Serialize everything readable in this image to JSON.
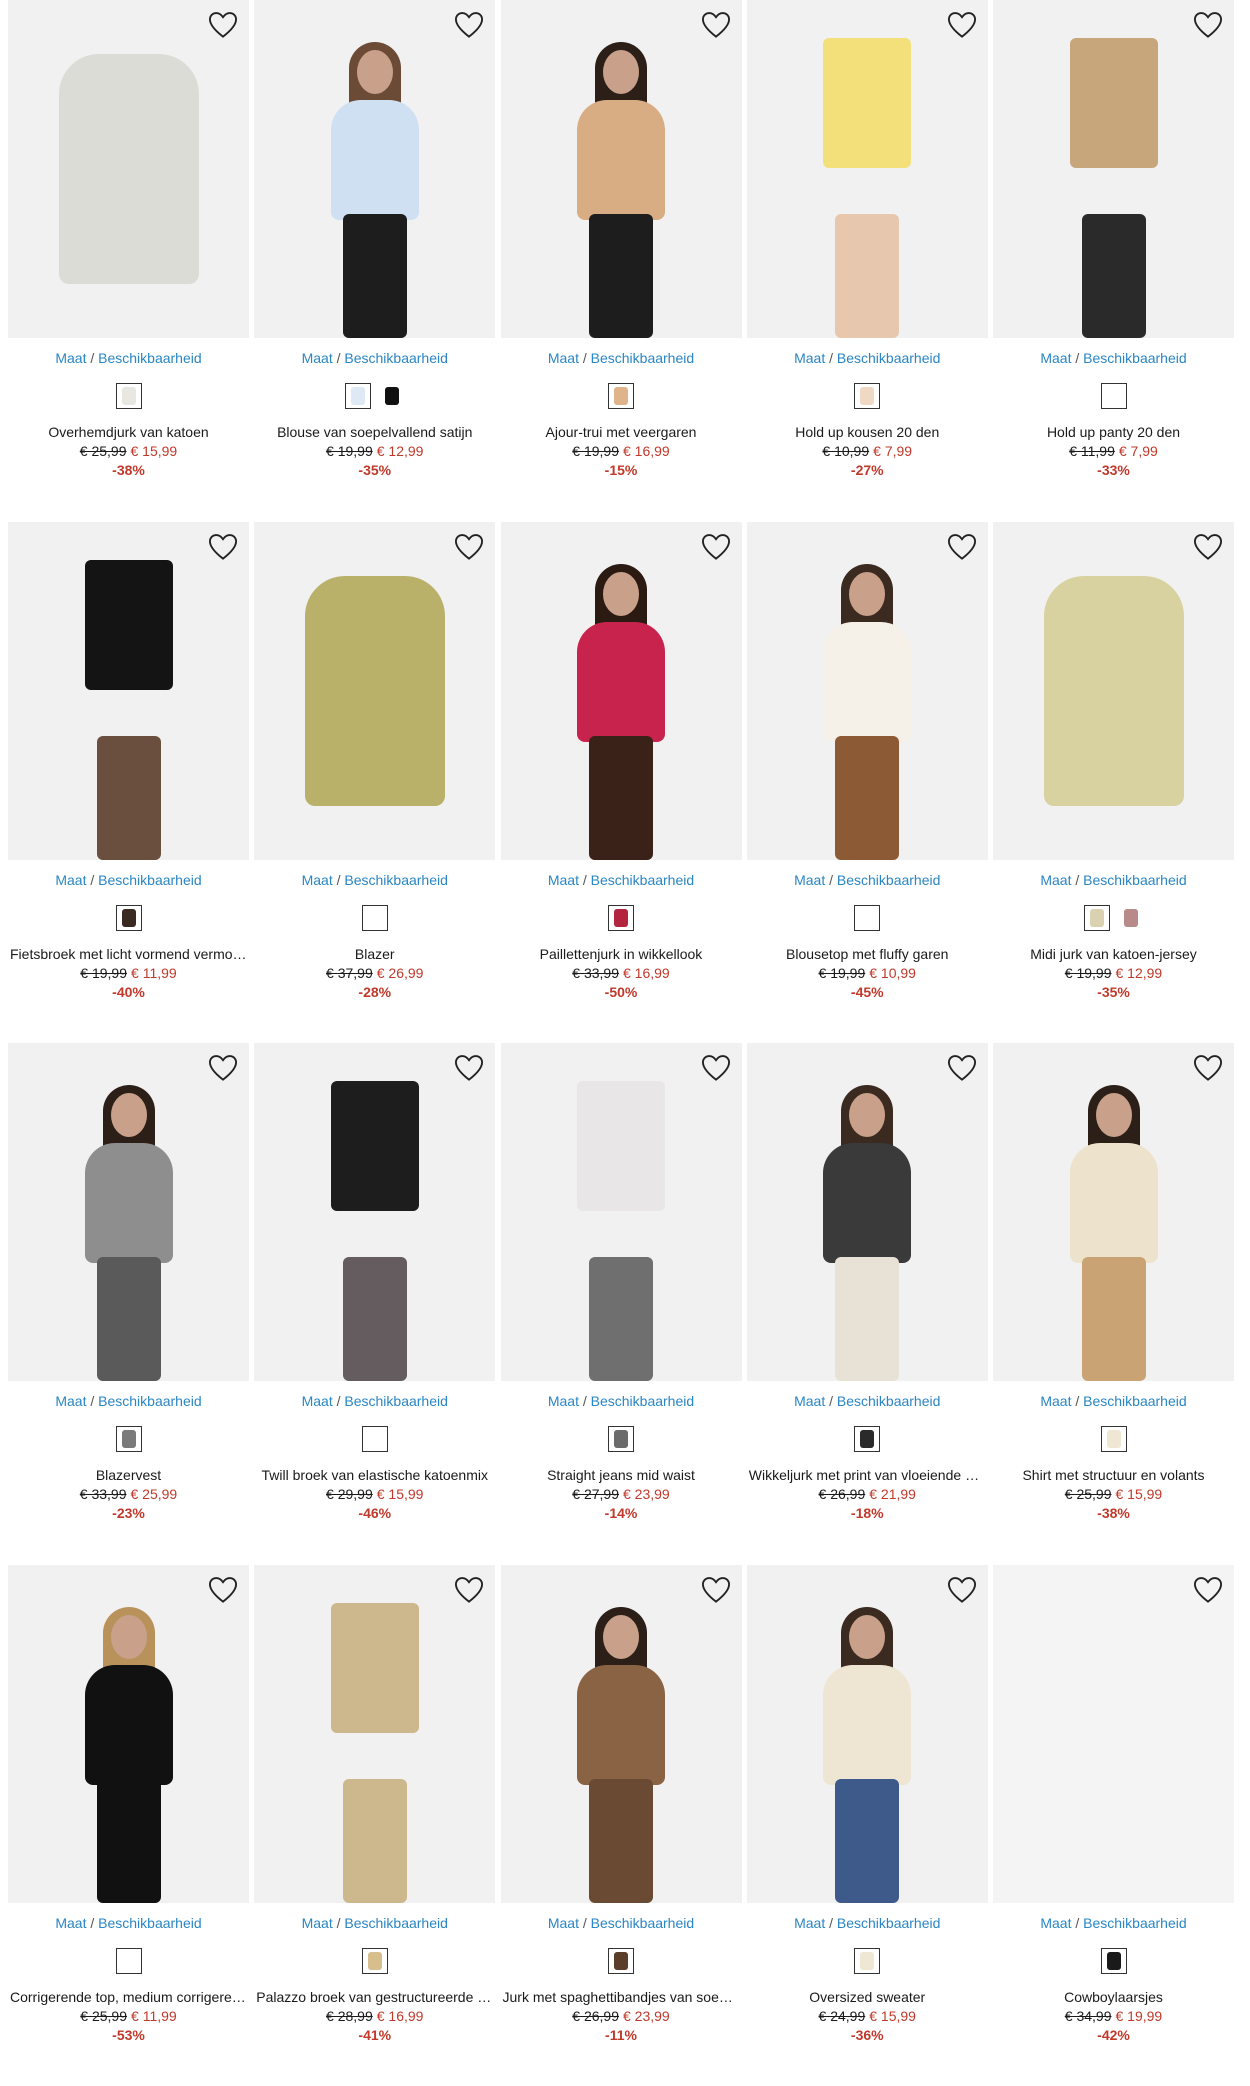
{
  "size_link": {
    "maat": "Maat",
    "sep": " / ",
    "beschikbaarheid": "Beschikbaarheid"
  },
  "colors": {
    "link": "#2a86c4",
    "sale": "#c0392b",
    "text": "#1a1a1a"
  },
  "products": [
    {
      "title": "Overhemdjurk van katoen",
      "old_price": "€ 25,99",
      "new_price": "€ 15,99",
      "discount": "-38%",
      "swatches": [
        "#e9e7e2"
      ],
      "image": {
        "kind": "flat",
        "color": "#dcdcd6"
      }
    },
    {
      "title": "Blouse van soepelvallend satijn",
      "old_price": "€ 19,99",
      "new_price": "€ 12,99",
      "discount": "-35%",
      "swatches": [
        "#dfe9f5",
        "#111111"
      ],
      "image": {
        "kind": "model",
        "top": "#cfe0f2",
        "bottom": "#1d1d1d",
        "hair": "#6b4b36"
      }
    },
    {
      "title": "Ajour-trui met veergaren",
      "old_price": "€ 19,99",
      "new_price": "€ 16,99",
      "discount": "-15%",
      "swatches": [
        "#e0b48a"
      ],
      "image": {
        "kind": "model",
        "top": "#d9ad83",
        "bottom": "#1d1d1d",
        "hair": "#2b1f18"
      }
    },
    {
      "title": "Hold up kousen 20 den",
      "old_price": "€ 10,99",
      "new_price": "€ 7,99",
      "discount": "-27%",
      "swatches": [
        "#efd8c4"
      ],
      "image": {
        "kind": "legs",
        "top": "#f3e07a",
        "bottom": "#e7c7ae",
        "hair": "#e7c7ae"
      }
    },
    {
      "title": "Hold up panty 20 den",
      "old_price": "€ 11,99",
      "new_price": "€ 7,99",
      "discount": "-33%",
      "swatches": [],
      "image": {
        "kind": "legs",
        "top": "#c8a67c",
        "bottom": "#2a2a2a",
        "hair": "#1d1d1d"
      }
    },
    {
      "title": "Fietsbroek met licht vormend vermogen",
      "old_price": "€ 19,99",
      "new_price": "€ 11,99",
      "discount": "-40%",
      "swatches": [
        "#3a2a22"
      ],
      "image": {
        "kind": "legs",
        "top": "#141414",
        "bottom": "#6b4f3e",
        "hair": "#c48e6c"
      }
    },
    {
      "title": "Blazer",
      "old_price": "€ 37,99",
      "new_price": "€ 26,99",
      "discount": "-28%",
      "swatches": [],
      "image": {
        "kind": "flat",
        "color": "#b9b169"
      }
    },
    {
      "title": "Paillettenjurk in wikkellook",
      "old_price": "€ 33,99",
      "new_price": "€ 16,99",
      "discount": "-50%",
      "swatches": [
        "#b3243f"
      ],
      "image": {
        "kind": "model",
        "top": "#c8234c",
        "bottom": "#3a2218",
        "hair": "#2a1a12"
      }
    },
    {
      "title": "Blousetop met fluffy garen",
      "old_price": "€ 19,99",
      "new_price": "€ 10,99",
      "discount": "-45%",
      "swatches": [],
      "image": {
        "kind": "model",
        "top": "#f5f1e8",
        "bottom": "#8c5a34",
        "hair": "#3b2a20"
      }
    },
    {
      "title": "Midi jurk van katoen-jersey",
      "old_price": "€ 19,99",
      "new_price": "€ 12,99",
      "discount": "-35%",
      "swatches": [
        "#d9d1b0",
        "#b88a8a"
      ],
      "image": {
        "kind": "flat",
        "color": "#d8d2a0"
      }
    },
    {
      "title": "Blazervest",
      "old_price": "€ 33,99",
      "new_price": "€ 25,99",
      "discount": "-23%",
      "swatches": [
        "#7a7a7a"
      ],
      "image": {
        "kind": "model",
        "top": "#8e8e8e",
        "bottom": "#5a5a5a",
        "hair": "#2b1f18"
      }
    },
    {
      "title": "Twill broek van elastische katoenmix",
      "old_price": "€ 29,99",
      "new_price": "€ 15,99",
      "discount": "-46%",
      "swatches": [],
      "image": {
        "kind": "legs",
        "top": "#1d1d1d",
        "bottom": "#645c5e",
        "hair": "#1d1d1d"
      }
    },
    {
      "title": "Straight jeans mid waist",
      "old_price": "€ 27,99",
      "new_price": "€ 23,99",
      "discount": "-14%",
      "swatches": [
        "#6b6b6b"
      ],
      "image": {
        "kind": "legs",
        "top": "#e8e6e6",
        "bottom": "#6f6f6f",
        "hair": "#e8e6e6"
      }
    },
    {
      "title": "Wikkeljurk met print van vloeiende viscose",
      "old_price": "€ 26,99",
      "new_price": "€ 21,99",
      "discount": "-18%",
      "swatches": [
        "#2a2a2a"
      ],
      "image": {
        "kind": "model",
        "top": "#3a3a3a",
        "bottom": "#e8e2d6",
        "hair": "#3b2a20"
      }
    },
    {
      "title": "Shirt met structuur en volants",
      "old_price": "€ 25,99",
      "new_price": "€ 15,99",
      "discount": "-38%",
      "swatches": [
        "#efe6d3"
      ],
      "image": {
        "kind": "model",
        "top": "#ede3cc",
        "bottom": "#c9a374",
        "hair": "#2b1f18"
      }
    },
    {
      "title": "Corrigerende top, medium corrigerend",
      "old_price": "€ 25,99",
      "new_price": "€ 11,99",
      "discount": "-53%",
      "swatches": [],
      "image": {
        "kind": "model",
        "top": "#111111",
        "bottom": "#111111",
        "hair": "#b8925a"
      }
    },
    {
      "title": "Palazzo broek van gestructureerde stof",
      "old_price": "€ 28,99",
      "new_price": "€ 16,99",
      "discount": "-41%",
      "swatches": [
        "#d6bf8c"
      ],
      "image": {
        "kind": "legs",
        "top": "#cdb88e",
        "bottom": "#cdb88e",
        "hair": "#cdb88e"
      }
    },
    {
      "title": "Jurk met spaghettibandjes van soepelvallend materiaal",
      "old_price": "€ 26,99",
      "new_price": "€ 23,99",
      "discount": "-11%",
      "swatches": [
        "#5a3e2a"
      ],
      "image": {
        "kind": "model",
        "top": "#8a6244",
        "bottom": "#6a4a32",
        "hair": "#2b1f18"
      }
    },
    {
      "title": "Oversized sweater",
      "old_price": "€ 24,99",
      "new_price": "€ 15,99",
      "discount": "-36%",
      "swatches": [
        "#efe7d4"
      ],
      "image": {
        "kind": "model",
        "top": "#eee6d2",
        "bottom": "#3d5a8a",
        "hair": "#3b2a20"
      }
    },
    {
      "title": "Cowboylaarsjes",
      "old_price": "€ 34,99",
      "new_price": "€ 19,99",
      "discount": "-42%",
      "swatches": [
        "#1a1a1a"
      ],
      "image": {
        "kind": "empty"
      }
    }
  ]
}
